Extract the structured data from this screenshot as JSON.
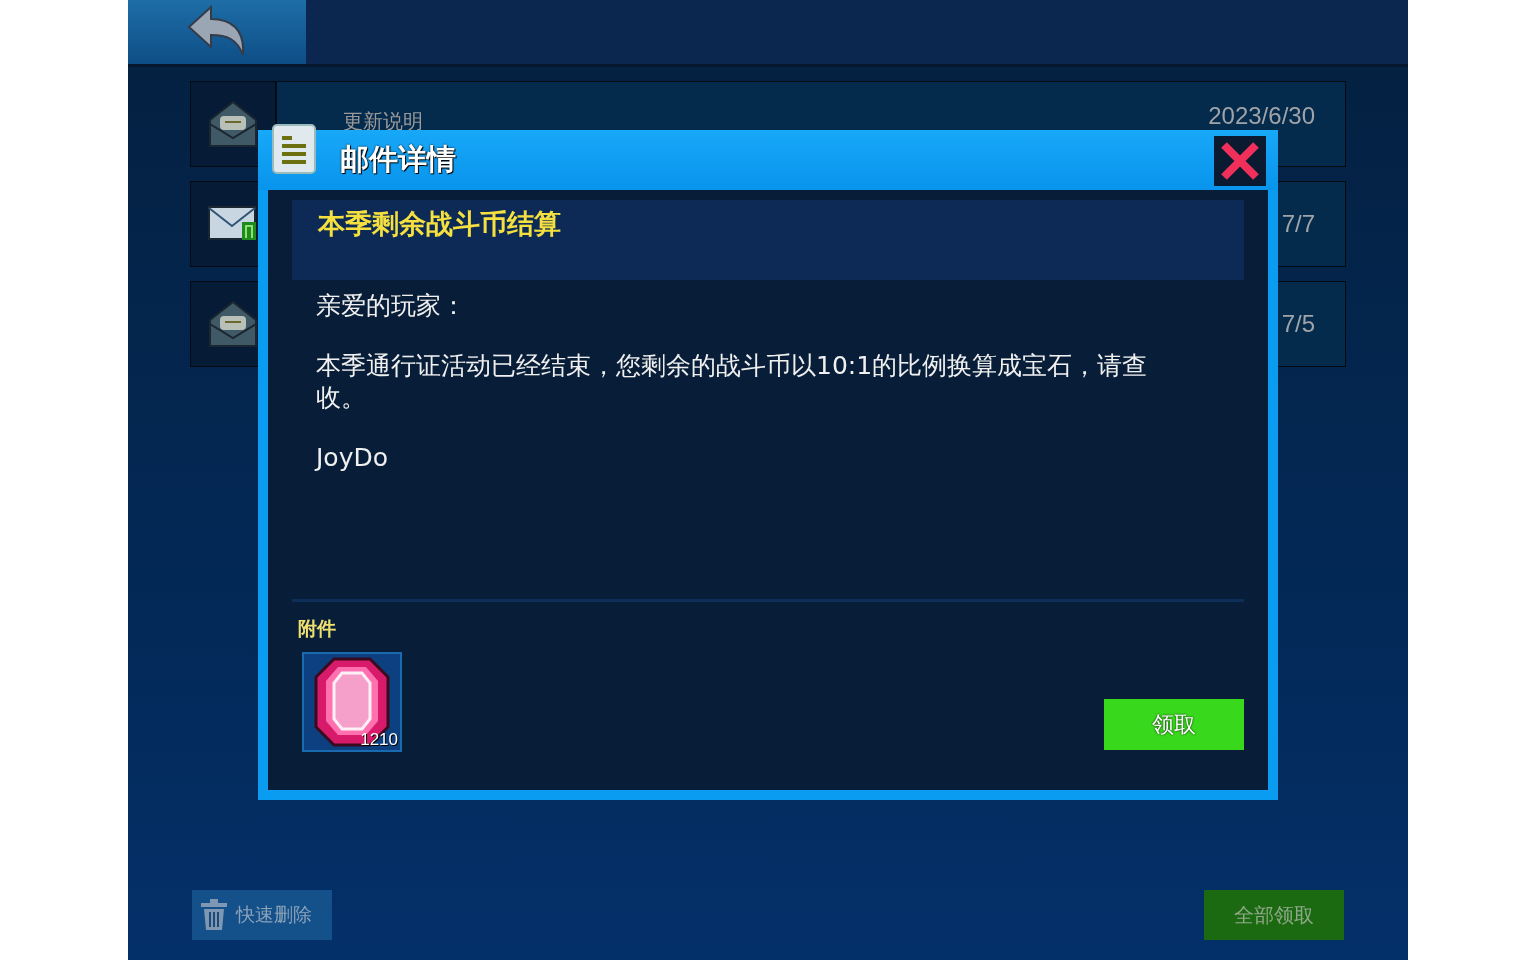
{
  "mail_list": [
    {
      "kind": "opened",
      "title": "更新说明",
      "date": "2023/6/30"
    },
    {
      "kind": "attachment",
      "date": "7/7"
    },
    {
      "kind": "opened",
      "date": "7/5"
    }
  ],
  "dialog": {
    "title": "邮件详情",
    "subject": "本季剩余战斗币结算",
    "body": [
      "亲爱的玩家：",
      "本季通行证活动已经结束，您剩余的战斗币以10:1的比例换算成宝石，请查收。",
      "JoyDo"
    ],
    "attachments_label": "附件",
    "attachments": [
      {
        "kind": "gem",
        "count": "1210"
      }
    ],
    "claim_button": "领取"
  },
  "bottom_bar": {
    "delete_button": "快速删除",
    "claim_all_button": "全部领取"
  }
}
